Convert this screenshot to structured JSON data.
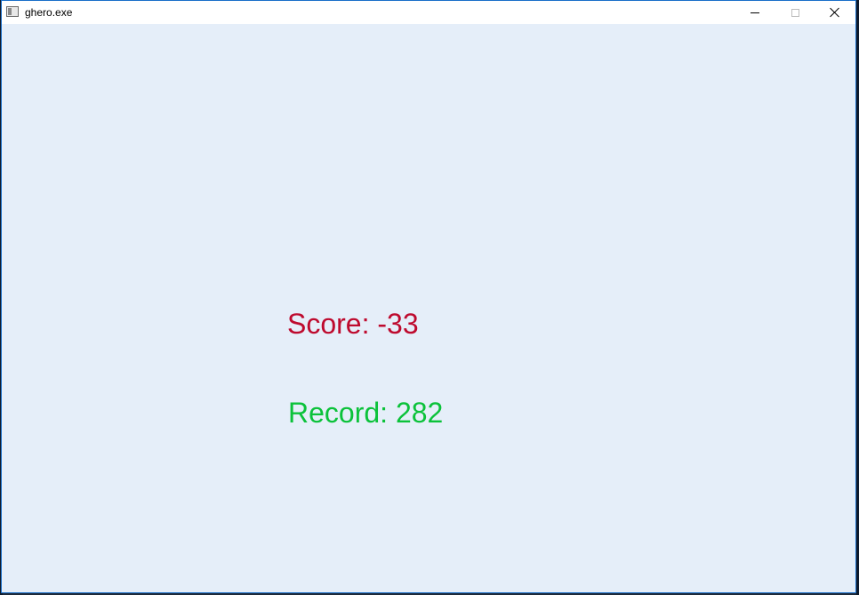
{
  "window": {
    "title": "ghero.exe",
    "icon": "app-window-icon",
    "controls": {
      "minimize_icon": "minimize-icon",
      "maximize_icon": "maximize-icon",
      "close_icon": "close-icon"
    }
  },
  "game": {
    "background_color": "#e5eef9",
    "score_text": "Score: -33",
    "score_value": -33,
    "score_color": "#be0a2e",
    "record_text": "Record: 282",
    "record_value": 282,
    "record_color": "#0bc23a"
  }
}
